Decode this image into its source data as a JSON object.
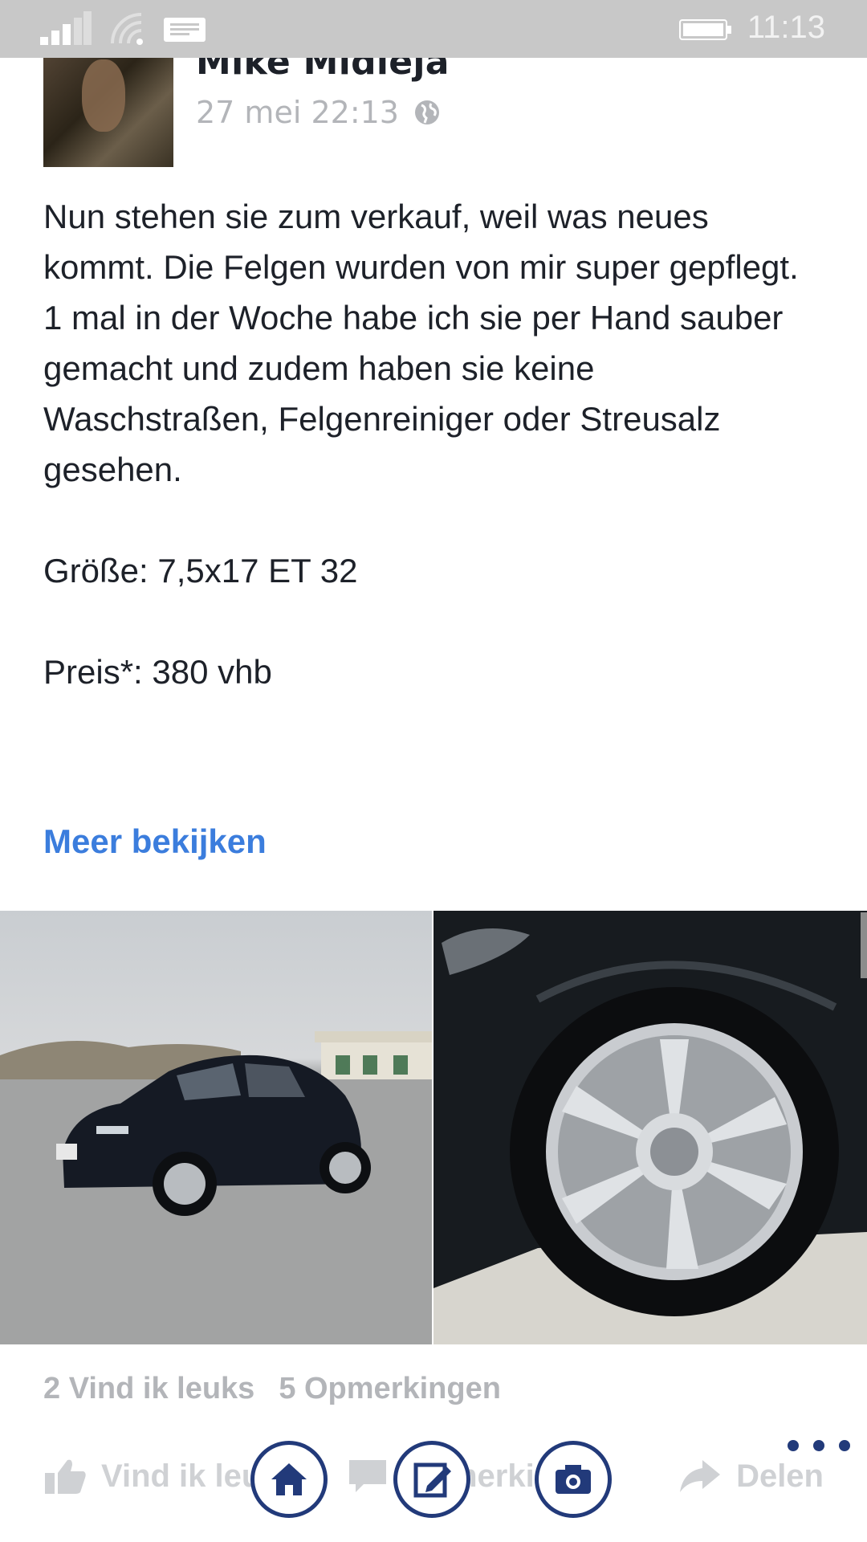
{
  "status_bar": {
    "time": "11:13",
    "icons": [
      "signal-icon",
      "wifi-icon",
      "message-icon",
      "battery-icon"
    ]
  },
  "post": {
    "author": "Mike Midleja",
    "timestamp": "27 mei 22:13",
    "privacy_icon": "globe-icon",
    "paragraphs": [
      "Nun stehen sie zum verkauf, weil was neues kommt. Die Felgen wurden von mir super gepflegt.",
      "1 mal in der Woche habe ich sie per Hand sauber gemacht und zudem haben sie keine Waschstraßen, Felgenreiniger oder Streusalz gesehen.",
      "",
      "Größe: 7,5x17 ET 32",
      "",
      "Preis*: 380 vhb"
    ],
    "see_more": "Meer bekijken",
    "photos": [
      "car-photo",
      "wheel-photo"
    ]
  },
  "stats": {
    "likes": "2 Vind ik leuks",
    "comments": "5 Opmerkingen"
  },
  "actions": {
    "like": "Vind ik leuk",
    "comment": "Opmerkingen",
    "share": "Delen"
  },
  "nav": {
    "icons": [
      "home-icon",
      "edit-icon",
      "camera-icon"
    ]
  },
  "colors": {
    "status_bar": "#c8c8c8",
    "link": "#3b7ddd",
    "nav_ring": "#223a7a",
    "muted": "#b3b5b9"
  }
}
